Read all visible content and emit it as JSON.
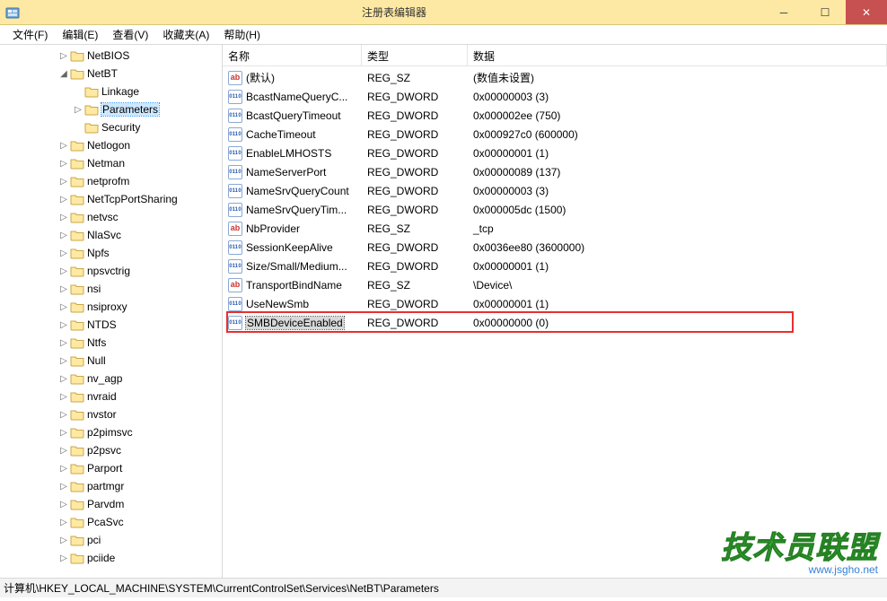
{
  "window": {
    "title": "注册表编辑器"
  },
  "menu": {
    "file": "文件(F)",
    "edit": "编辑(E)",
    "view": "查看(V)",
    "favorites": "收藏夹(A)",
    "help": "帮助(H)"
  },
  "tree": {
    "items": [
      {
        "indent": 4,
        "expander": "▷",
        "label": "NetBIOS"
      },
      {
        "indent": 4,
        "expander": "◢",
        "label": "NetBT"
      },
      {
        "indent": 5,
        "expander": "",
        "label": "Linkage"
      },
      {
        "indent": 5,
        "expander": "▷",
        "label": "Parameters",
        "selected": true
      },
      {
        "indent": 5,
        "expander": "",
        "label": "Security"
      },
      {
        "indent": 4,
        "expander": "▷",
        "label": "Netlogon"
      },
      {
        "indent": 4,
        "expander": "▷",
        "label": "Netman"
      },
      {
        "indent": 4,
        "expander": "▷",
        "label": "netprofm"
      },
      {
        "indent": 4,
        "expander": "▷",
        "label": "NetTcpPortSharing"
      },
      {
        "indent": 4,
        "expander": "▷",
        "label": "netvsc"
      },
      {
        "indent": 4,
        "expander": "▷",
        "label": "NlaSvc"
      },
      {
        "indent": 4,
        "expander": "▷",
        "label": "Npfs"
      },
      {
        "indent": 4,
        "expander": "▷",
        "label": "npsvctrig"
      },
      {
        "indent": 4,
        "expander": "▷",
        "label": "nsi"
      },
      {
        "indent": 4,
        "expander": "▷",
        "label": "nsiproxy"
      },
      {
        "indent": 4,
        "expander": "▷",
        "label": "NTDS"
      },
      {
        "indent": 4,
        "expander": "▷",
        "label": "Ntfs"
      },
      {
        "indent": 4,
        "expander": "▷",
        "label": "Null"
      },
      {
        "indent": 4,
        "expander": "▷",
        "label": "nv_agp"
      },
      {
        "indent": 4,
        "expander": "▷",
        "label": "nvraid"
      },
      {
        "indent": 4,
        "expander": "▷",
        "label": "nvstor"
      },
      {
        "indent": 4,
        "expander": "▷",
        "label": "p2pimsvc"
      },
      {
        "indent": 4,
        "expander": "▷",
        "label": "p2psvc"
      },
      {
        "indent": 4,
        "expander": "▷",
        "label": "Parport"
      },
      {
        "indent": 4,
        "expander": "▷",
        "label": "partmgr"
      },
      {
        "indent": 4,
        "expander": "▷",
        "label": "Parvdm"
      },
      {
        "indent": 4,
        "expander": "▷",
        "label": "PcaSvc"
      },
      {
        "indent": 4,
        "expander": "▷",
        "label": "pci"
      },
      {
        "indent": 4,
        "expander": "▷",
        "label": "pciide"
      }
    ]
  },
  "list": {
    "columns": {
      "name": "名称",
      "type": "类型",
      "data": "数据"
    },
    "rows": [
      {
        "icon": "sz",
        "name": "(默认)",
        "type": "REG_SZ",
        "data": "(数值未设置)"
      },
      {
        "icon": "bin",
        "name": "BcastNameQueryC...",
        "type": "REG_DWORD",
        "data": "0x00000003 (3)"
      },
      {
        "icon": "bin",
        "name": "BcastQueryTimeout",
        "type": "REG_DWORD",
        "data": "0x000002ee (750)"
      },
      {
        "icon": "bin",
        "name": "CacheTimeout",
        "type": "REG_DWORD",
        "data": "0x000927c0 (600000)"
      },
      {
        "icon": "bin",
        "name": "EnableLMHOSTS",
        "type": "REG_DWORD",
        "data": "0x00000001 (1)"
      },
      {
        "icon": "bin",
        "name": "NameServerPort",
        "type": "REG_DWORD",
        "data": "0x00000089 (137)"
      },
      {
        "icon": "bin",
        "name": "NameSrvQueryCount",
        "type": "REG_DWORD",
        "data": "0x00000003 (3)"
      },
      {
        "icon": "bin",
        "name": "NameSrvQueryTim...",
        "type": "REG_DWORD",
        "data": "0x000005dc (1500)"
      },
      {
        "icon": "sz",
        "name": "NbProvider",
        "type": "REG_SZ",
        "data": "_tcp"
      },
      {
        "icon": "bin",
        "name": "SessionKeepAlive",
        "type": "REG_DWORD",
        "data": "0x0036ee80 (3600000)"
      },
      {
        "icon": "bin",
        "name": "Size/Small/Medium...",
        "type": "REG_DWORD",
        "data": "0x00000001 (1)"
      },
      {
        "icon": "sz",
        "name": "TransportBindName",
        "type": "REG_SZ",
        "data": "\\Device\\"
      },
      {
        "icon": "bin",
        "name": "UseNewSmb",
        "type": "REG_DWORD",
        "data": "0x00000001 (1)"
      },
      {
        "icon": "bin",
        "name": "SMBDeviceEnabled",
        "type": "REG_DWORD",
        "data": "0x00000000 (0)",
        "selected": true
      }
    ]
  },
  "statusbar": {
    "label": "计算机",
    "path": "\\HKEY_LOCAL_MACHINE\\SYSTEM\\CurrentControlSet\\Services\\NetBT\\Parameters"
  },
  "watermark": {
    "big": "技术员联盟",
    "small": "www.jsgho.net"
  }
}
